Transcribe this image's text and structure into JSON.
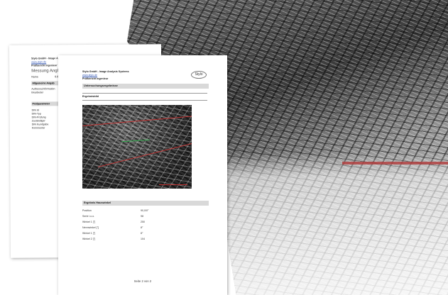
{
  "back_page": {
    "company": "Stylo GmbH - Image A",
    "link": "www.stylo.de",
    "subtitle": "Prüfbericht Ingenieur",
    "title": "Messung Angle ↓",
    "meta_key": "Name",
    "meta_val": "8.8.15",
    "section1": "Allgemeine Angab",
    "section1_items": [
      "Auftrennsinformation",
      "Bearbeiter"
    ],
    "section2": "Prüfparameter",
    "section2_items": [
      "DIN Id",
      "DIN-Typ",
      "DIN-Prüfung",
      "Zuständiger",
      "DIN Kundgabe",
      "Kommentar"
    ]
  },
  "front_page": {
    "company": "Stylo GmbH - Image Analysis Systems",
    "link": "www.stylo.de",
    "subtitle": "Prüfbericht Ingenieur",
    "logo": "Stylo",
    "section_bar": "Untersuchungsergebnisse",
    "image_label": "Ergebnisbild",
    "results_bar": "Ergebnis Hauswinkel",
    "results": [
      {
        "key": "Position",
        "value": "90,0/0°"
      },
      {
        "key": "Serie i.o.o.",
        "value": "98"
      },
      {
        "key": "Winkel 1 [°]",
        "value": "250"
      },
      {
        "key": "Nennwinkel [°]",
        "value": "8°"
      },
      {
        "key": "Winkel 1 [°]",
        "value": "8°"
      },
      {
        "key": "Winkel 2 [°]",
        "value": "104"
      }
    ],
    "footer": "Seite 2 von 2"
  }
}
